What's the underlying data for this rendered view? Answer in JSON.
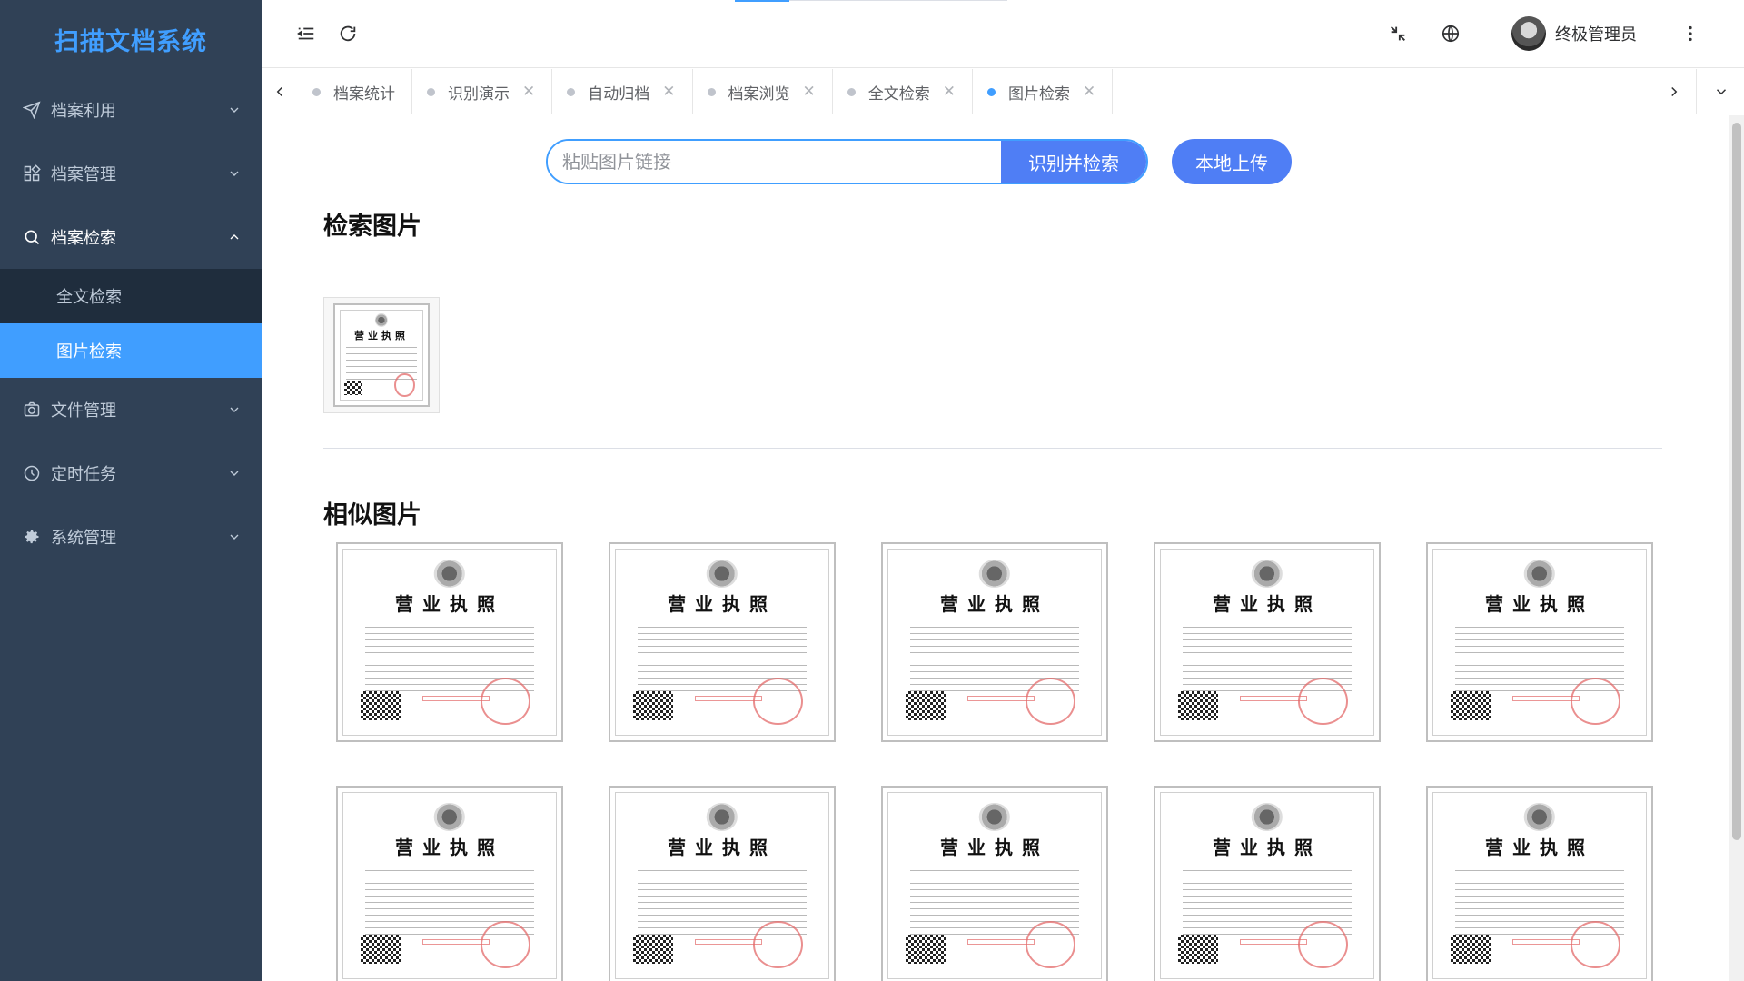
{
  "app": {
    "title": "扫描文档系统"
  },
  "sidebar": {
    "items": [
      {
        "label": "档案利用",
        "icon": "send-icon",
        "expanded": false
      },
      {
        "label": "档案管理",
        "icon": "grid-icon",
        "expanded": false
      },
      {
        "label": "档案检索",
        "icon": "search-icon",
        "expanded": true,
        "children": [
          {
            "label": "全文检索",
            "active": false
          },
          {
            "label": "图片检索",
            "active": true
          }
        ]
      },
      {
        "label": "文件管理",
        "icon": "camera-icon",
        "expanded": false
      },
      {
        "label": "定时任务",
        "icon": "clock-icon",
        "expanded": false
      },
      {
        "label": "系统管理",
        "icon": "gear-icon",
        "expanded": false
      }
    ]
  },
  "header": {
    "user_name": "终极管理员",
    "icons": [
      "menu-fold-icon",
      "refresh-icon",
      "fullscreen-exit-icon",
      "language-icon",
      "more-vertical-icon"
    ]
  },
  "tabs": [
    {
      "label": "档案统计",
      "active": false,
      "closable": false
    },
    {
      "label": "识别演示",
      "active": false,
      "closable": true
    },
    {
      "label": "自动归档",
      "active": false,
      "closable": true
    },
    {
      "label": "档案浏览",
      "active": false,
      "closable": true
    },
    {
      "label": "全文检索",
      "active": false,
      "closable": true
    },
    {
      "label": "图片检索",
      "active": true,
      "closable": true
    }
  ],
  "search": {
    "placeholder": "粘贴图片链接",
    "value": "",
    "submit_label": "识别并检索",
    "upload_label": "本地上传"
  },
  "query_section": {
    "title": "检索图片",
    "image": {
      "title": "营业执照"
    }
  },
  "results_section": {
    "title": "相似图片",
    "images": [
      {
        "title": "营业执照"
      },
      {
        "title": "营业执照"
      },
      {
        "title": "营业执照"
      },
      {
        "title": "营业执照"
      },
      {
        "title": "营业执照"
      },
      {
        "title": "营业执照"
      },
      {
        "title": "营业执照"
      },
      {
        "title": "营业执照"
      },
      {
        "title": "营业执照"
      },
      {
        "title": "营业执照"
      }
    ]
  },
  "colors": {
    "sidebar_bg": "#304156",
    "submenu_bg": "#1f2d3d",
    "accent": "#409eff",
    "button": "#4f7ef5"
  }
}
